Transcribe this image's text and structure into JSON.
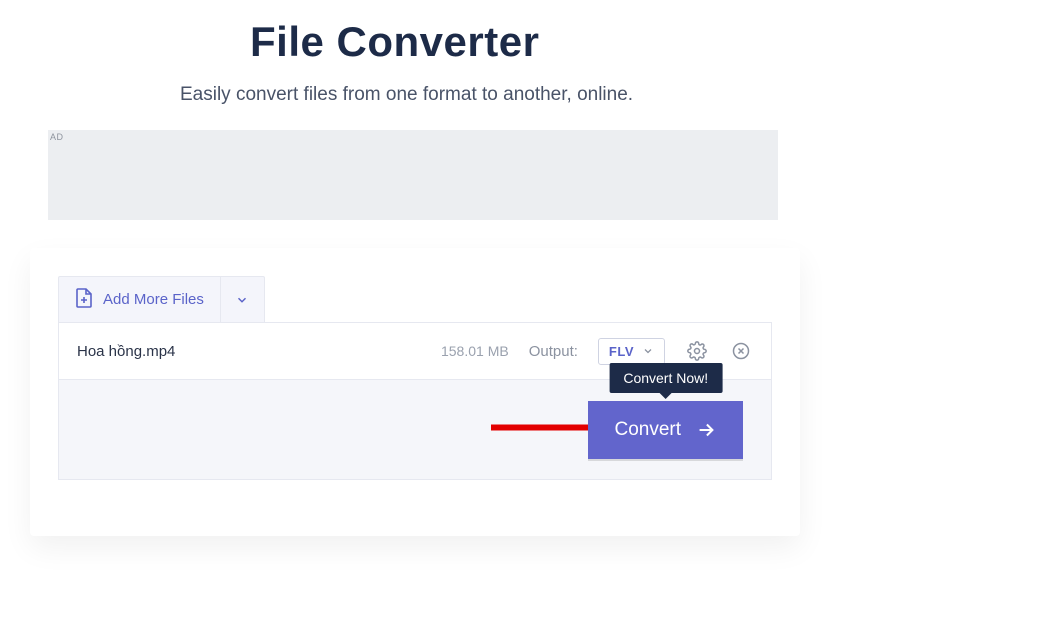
{
  "hero": {
    "title": "File Converter",
    "subtitle": "Easily convert files from one format to another, online."
  },
  "ad": {
    "label": "AD"
  },
  "addbar": {
    "label": "Add More Files"
  },
  "file": {
    "name": "Hoa hồng.mp4",
    "size": "158.01 MB",
    "output_label": "Output:",
    "format": "FLV"
  },
  "tooltip": {
    "text": "Convert Now!"
  },
  "convert": {
    "label": "Convert"
  }
}
